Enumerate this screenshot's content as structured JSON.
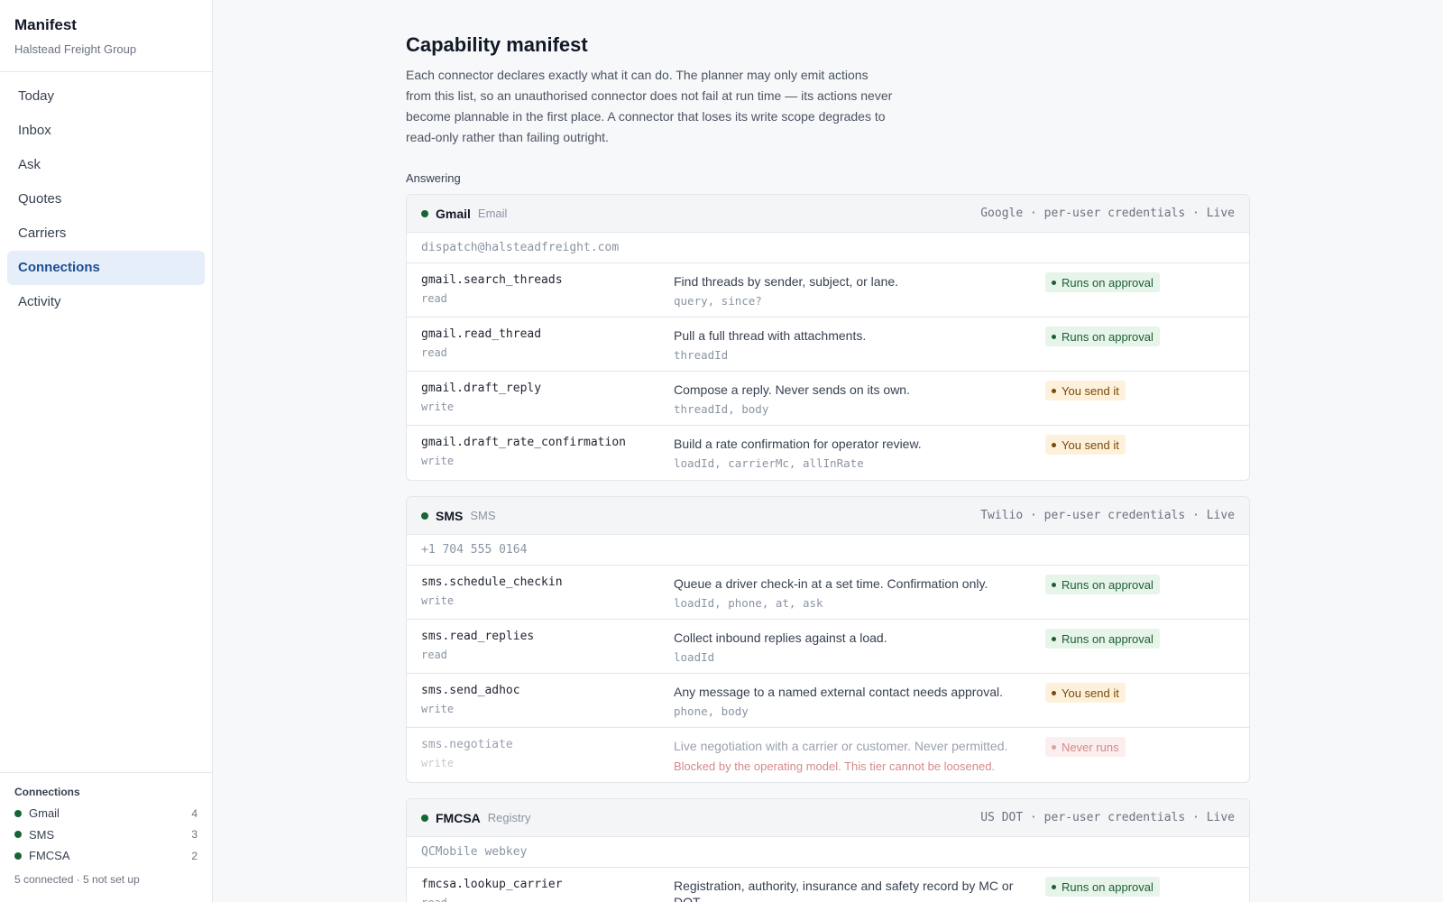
{
  "app": {
    "title": "Manifest",
    "org": "Halstead Freight Group"
  },
  "nav": [
    {
      "label": "Today",
      "active": false
    },
    {
      "label": "Inbox",
      "active": false
    },
    {
      "label": "Ask",
      "active": false
    },
    {
      "label": "Quotes",
      "active": false
    },
    {
      "label": "Carriers",
      "active": false
    },
    {
      "label": "Connections",
      "active": true
    },
    {
      "label": "Activity",
      "active": false
    }
  ],
  "sidebar_footer": {
    "title": "Connections",
    "items": [
      {
        "name": "Gmail",
        "count": "4"
      },
      {
        "name": "SMS",
        "count": "3"
      },
      {
        "name": "FMCSA",
        "count": "2"
      }
    ],
    "summary": "5 connected · 5 not set up"
  },
  "page": {
    "title": "Capability manifest",
    "description": "Each connector declares exactly what it can do. The planner may only emit actions from this list, so an unauthorised connector does not fail at run time — its actions never become plannable in the first place. A connector that loses its write scope degrades to read-only rather than failing outright.",
    "section_label": "Answering"
  },
  "connectors": [
    {
      "name": "Gmail",
      "kind": "Email",
      "meta": "Google · per-user credentials · Live",
      "account": "dispatch@halsteadfreight.com",
      "actions": [
        {
          "name": "gmail.search_threads",
          "scope": "read",
          "desc": "Find threads by sender, subject, or lane.",
          "params": "query, since?",
          "badge": "Runs on approval",
          "badge_type": "approve"
        },
        {
          "name": "gmail.read_thread",
          "scope": "read",
          "desc": "Pull a full thread with attachments.",
          "params": "threadId",
          "badge": "Runs on approval",
          "badge_type": "approve"
        },
        {
          "name": "gmail.draft_reply",
          "scope": "write",
          "desc": "Compose a reply. Never sends on its own.",
          "params": "threadId, body",
          "badge": "You send it",
          "badge_type": "yousend"
        },
        {
          "name": "gmail.draft_rate_confirmation",
          "scope": "write",
          "desc": "Build a rate confirmation for operator review.",
          "params": "loadId, carrierMc, allInRate",
          "badge": "You send it",
          "badge_type": "yousend"
        }
      ]
    },
    {
      "name": "SMS",
      "kind": "SMS",
      "meta": "Twilio · per-user credentials · Live",
      "account": "+1 704 555 0164",
      "actions": [
        {
          "name": "sms.schedule_checkin",
          "scope": "write",
          "desc": "Queue a driver check-in at a set time. Confirmation only.",
          "params": "loadId, phone, at, ask",
          "badge": "Runs on approval",
          "badge_type": "approve"
        },
        {
          "name": "sms.read_replies",
          "scope": "read",
          "desc": "Collect inbound replies against a load.",
          "params": "loadId",
          "badge": "Runs on approval",
          "badge_type": "approve"
        },
        {
          "name": "sms.send_adhoc",
          "scope": "write",
          "desc": "Any message to a named external contact needs approval.",
          "params": "phone, body",
          "badge": "You send it",
          "badge_type": "yousend"
        },
        {
          "name": "sms.negotiate",
          "scope": "write",
          "desc": "Live negotiation with a carrier or customer. Never permitted.",
          "params": "",
          "note": "Blocked by the operating model. This tier cannot be loosened.",
          "badge": "Never runs",
          "badge_type": "never",
          "disabled": true
        }
      ]
    },
    {
      "name": "FMCSA",
      "kind": "Registry",
      "meta": "US DOT · per-user credentials · Live",
      "account": "QCMobile webkey",
      "actions": [
        {
          "name": "fmcsa.lookup_carrier",
          "scope": "read",
          "desc": "Registration, authority, insurance and safety record by MC or DOT.",
          "params": "",
          "badge": "Runs on approval",
          "badge_type": "approve"
        }
      ]
    }
  ]
}
